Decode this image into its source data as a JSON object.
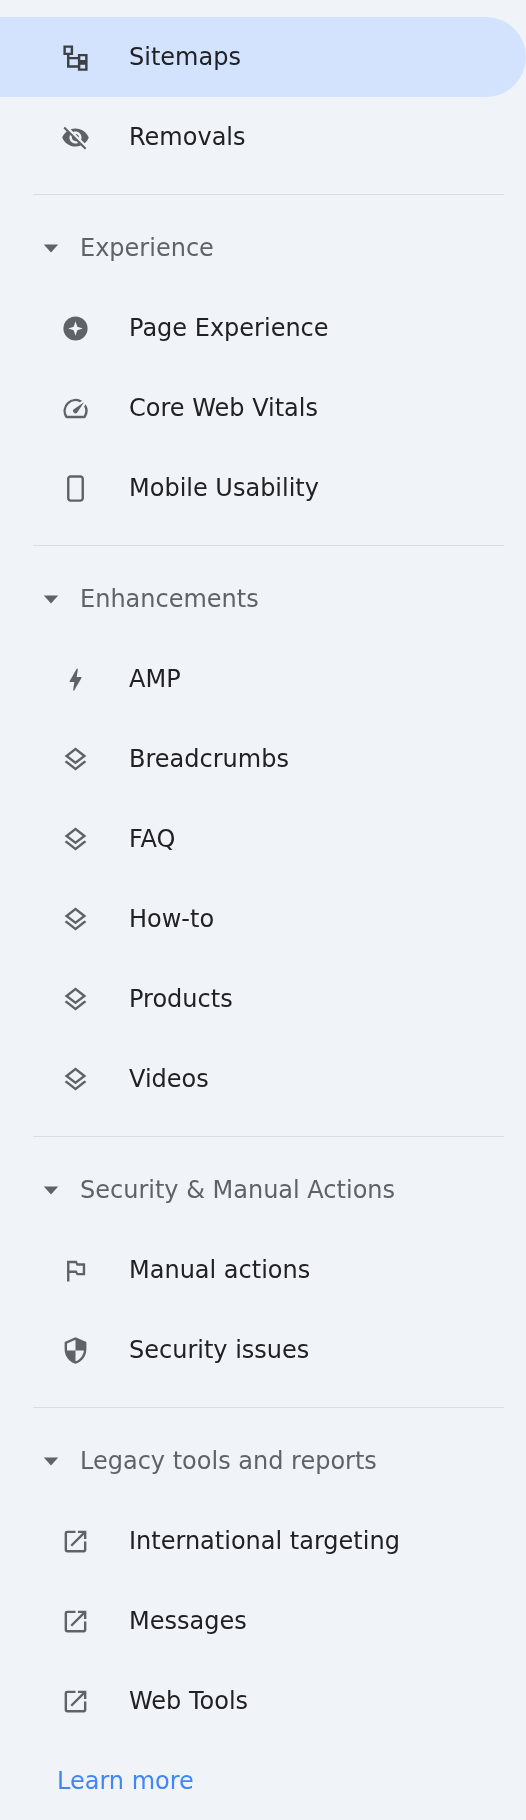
{
  "sections": [
    {
      "items": [
        {
          "label": "Sitemaps",
          "selected": true
        },
        {
          "label": "Removals",
          "selected": false
        }
      ]
    },
    {
      "title": "Experience",
      "expanded": true,
      "items": [
        {
          "label": "Page Experience",
          "selected": false
        },
        {
          "label": "Core Web Vitals",
          "selected": false
        },
        {
          "label": "Mobile Usability",
          "selected": false
        }
      ]
    },
    {
      "title": "Enhancements",
      "expanded": true,
      "items": [
        {
          "label": "AMP",
          "selected": false
        },
        {
          "label": "Breadcrumbs",
          "selected": false
        },
        {
          "label": "FAQ",
          "selected": false
        },
        {
          "label": "How-to",
          "selected": false
        },
        {
          "label": "Products",
          "selected": false
        },
        {
          "label": "Videos",
          "selected": false
        }
      ]
    },
    {
      "title": "Security & Manual Actions",
      "expanded": true,
      "items": [
        {
          "label": "Manual actions",
          "selected": false
        },
        {
          "label": "Security issues",
          "selected": false
        }
      ]
    },
    {
      "title": "Legacy tools and reports",
      "expanded": true,
      "items": [
        {
          "label": "International targeting",
          "selected": false
        },
        {
          "label": "Messages",
          "selected": false
        },
        {
          "label": "Web Tools",
          "selected": false
        }
      ]
    }
  ],
  "learn_more": "Learn more"
}
